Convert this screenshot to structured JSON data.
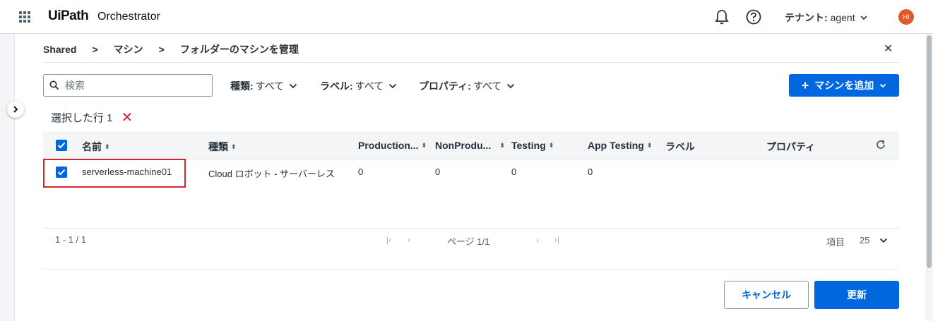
{
  "app": {
    "logo": "UiPath",
    "product": "Orchestrator",
    "tenant_label": "テナント:",
    "tenant_value": "agent",
    "avatar_initials": "HI"
  },
  "breadcrumb": {
    "items": [
      "Shared",
      "マシン",
      "フォルダーのマシンを管理"
    ],
    "separator": ">"
  },
  "toolbar": {
    "search_placeholder": "検索",
    "filters": [
      {
        "label": "種類:",
        "value": "すべて"
      },
      {
        "label": "ラベル:",
        "value": "すべて"
      },
      {
        "label": "プロパティ:",
        "value": "すべて"
      }
    ],
    "add_button": "マシンを追加"
  },
  "selection": {
    "text": "選択した行 1"
  },
  "table": {
    "columns": [
      "名前",
      "種類",
      "Production...",
      "NonProdu...",
      "Testing",
      "App Testing",
      "ラベル",
      "プロパティ"
    ],
    "rows": [
      {
        "checked": true,
        "name": "serverless-machine01",
        "type": "Cloud ロボット - サーバーレス",
        "production": "0",
        "nonproduction": "0",
        "testing": "0",
        "app_testing": "0",
        "labels": "",
        "properties": ""
      }
    ]
  },
  "pagination": {
    "range": "1 - 1 / 1",
    "page": "ページ 1/1",
    "items_label": "項目",
    "page_size": "25"
  },
  "footer": {
    "cancel": "キャンセル",
    "update": "更新"
  },
  "colors": {
    "primary": "#0067df",
    "highlight": "#d6232f",
    "avatar": "#e0592a"
  }
}
